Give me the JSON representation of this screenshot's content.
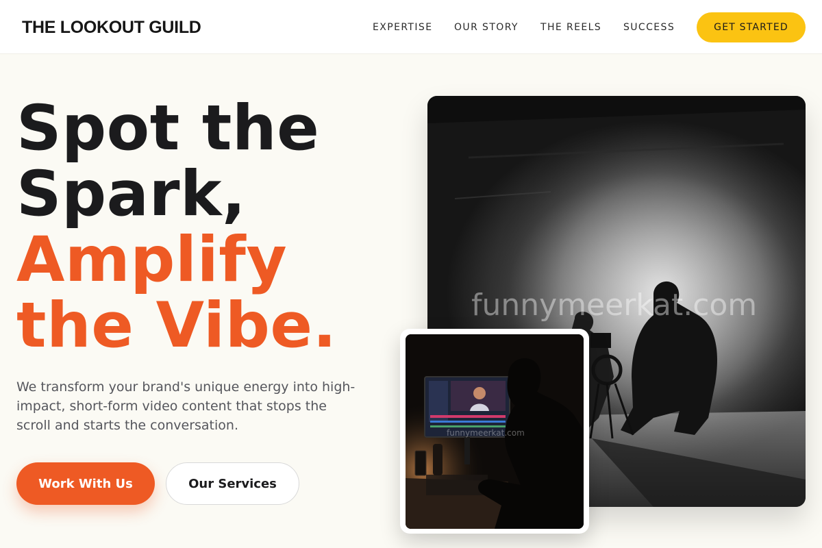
{
  "header": {
    "brand": "THE LOOKOUT GUILD",
    "nav": {
      "expertise": "EXPERTISE",
      "story": "OUR STORY",
      "reels": "THE REELS",
      "success": "SUCCESS"
    },
    "cta": "GET STARTED"
  },
  "hero": {
    "headline_line1": "Spot the",
    "headline_line2": "Spark,",
    "headline_line3": "Amplify",
    "headline_line4": "the Vibe.",
    "subcopy": "We transform your brand's unique energy into high-impact, short-form video content that stops the scroll and starts the conversation.",
    "primary_button": "Work With Us",
    "secondary_button": "Our Services"
  },
  "images": {
    "main_watermark": "funnymeerkat.com",
    "small_watermark": "funnymeerkat.com"
  },
  "colors": {
    "accent_orange": "#ee5a24",
    "accent_yellow": "#fbc312",
    "background": "#fbfaf4",
    "text_dark": "#1b1b1d"
  }
}
